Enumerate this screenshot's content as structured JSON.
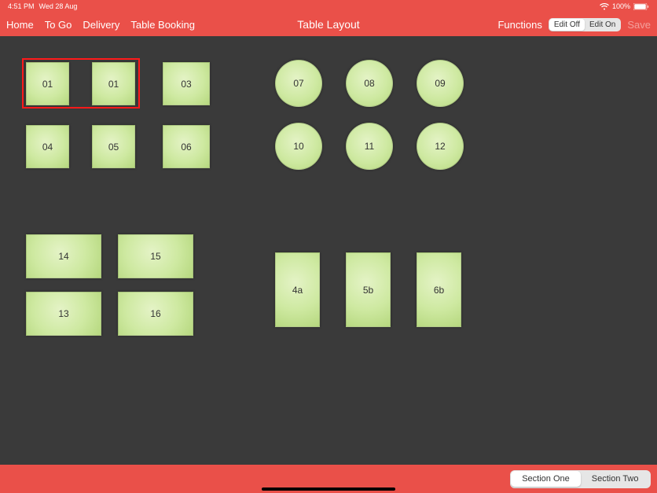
{
  "status": {
    "time": "4:51 PM",
    "date": "Wed 28 Aug",
    "battery_pct": "100%"
  },
  "nav": {
    "items": [
      "Home",
      "To Go",
      "Delivery",
      "Table Booking"
    ],
    "title": "Table Layout",
    "functions_label": "Functions",
    "edit_toggle": {
      "off": "Edit Off",
      "on": "Edit On",
      "active": "off"
    },
    "save_label": "Save"
  },
  "tables": {
    "t01a": "01",
    "t01b": "01",
    "t03": "03",
    "t04": "04",
    "t05": "05",
    "t06": "06",
    "t07": "07",
    "t08": "08",
    "t09": "09",
    "t10": "10",
    "t11": "11",
    "t12": "12",
    "t13": "13",
    "t14": "14",
    "t15": "15",
    "t16": "16",
    "t4a": "4a",
    "t5b": "5b",
    "t6b": "6b"
  },
  "sections": {
    "one": "Section One",
    "two": "Section Two",
    "active": "one"
  },
  "colors": {
    "accent": "#ea5049",
    "table_fill": "#d6eaab",
    "selection": "#ff1a1a"
  }
}
